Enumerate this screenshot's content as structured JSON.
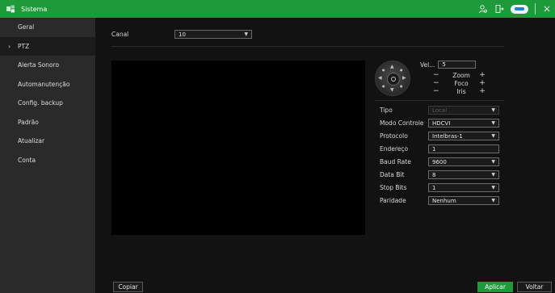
{
  "titlebar": {
    "title": "Sistema",
    "icons": [
      "app-logo-icon",
      "user-icon",
      "exit-icon",
      "cloud-icon",
      "close-icon"
    ]
  },
  "sidebar": {
    "items": [
      {
        "label": "Geral",
        "active": false
      },
      {
        "label": "PTZ",
        "active": true
      },
      {
        "label": "Alerta Sonoro",
        "active": false
      },
      {
        "label": "Automanutenção",
        "active": false
      },
      {
        "label": "Config. backup",
        "active": false
      },
      {
        "label": "Padrão",
        "active": false
      },
      {
        "label": "Atualizar",
        "active": false
      },
      {
        "label": "Conta",
        "active": false
      }
    ]
  },
  "main": {
    "canal_label": "Canal",
    "canal_value": "10",
    "ptz": {
      "vel_label": "Vel...",
      "vel_value": "5",
      "zoom_label": "Zoom",
      "foco_label": "Foco",
      "iris_label": "Iris",
      "minus": "−",
      "plus": "+"
    },
    "form": {
      "tipo_label": "Tipo",
      "tipo_value": "Local",
      "modo_label": "Modo Controle",
      "modo_value": "HDCVI",
      "protocolo_label": "Protocolo",
      "protocolo_value": "Intelbras-1",
      "endereco_label": "Endereço",
      "endereco_value": "1",
      "baud_label": "Baud Rate",
      "baud_value": "9600",
      "databit_label": "Data Bit",
      "databit_value": "8",
      "stopbits_label": "Stop Bits",
      "stopbits_value": "1",
      "paridade_label": "Paridade",
      "paridade_value": "Nenhum"
    },
    "buttons": {
      "copiar": "Copiar",
      "aplicar": "Aplicar",
      "voltar": "Voltar"
    }
  },
  "colors": {
    "accent": "#1f9a3a",
    "sidebar_bg": "#2a2a2a",
    "main_bg": "#121212"
  }
}
